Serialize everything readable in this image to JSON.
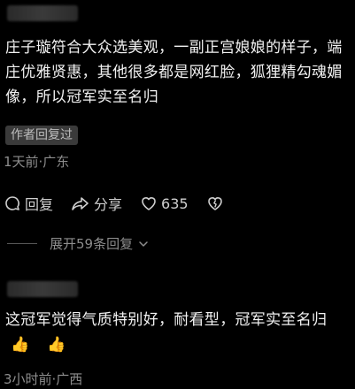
{
  "comment1": {
    "text": "庄子璇符合大众选美观，一副正宫娘娘的样子，端庄优雅贤惠，其他很多都是网红脸，狐狸精勾魂媚像，所以冠军实至名归",
    "author_tag": "作者回复过",
    "meta": "1天前·广东",
    "actions": {
      "reply_label": "回复",
      "share_label": "分享",
      "like_count": "635"
    },
    "expand_label": "展开59条回复"
  },
  "comment2": {
    "text": "这冠军觉得气质特别好，耐看型，冠军实至名归",
    "emoji": "👍",
    "meta": "3小时前·广西"
  },
  "icons": {
    "reply": "comment-icon",
    "share": "share-arrow-icon",
    "like": "heart-icon",
    "dislike": "broken-heart-icon",
    "expand": "chevron-down-icon"
  }
}
